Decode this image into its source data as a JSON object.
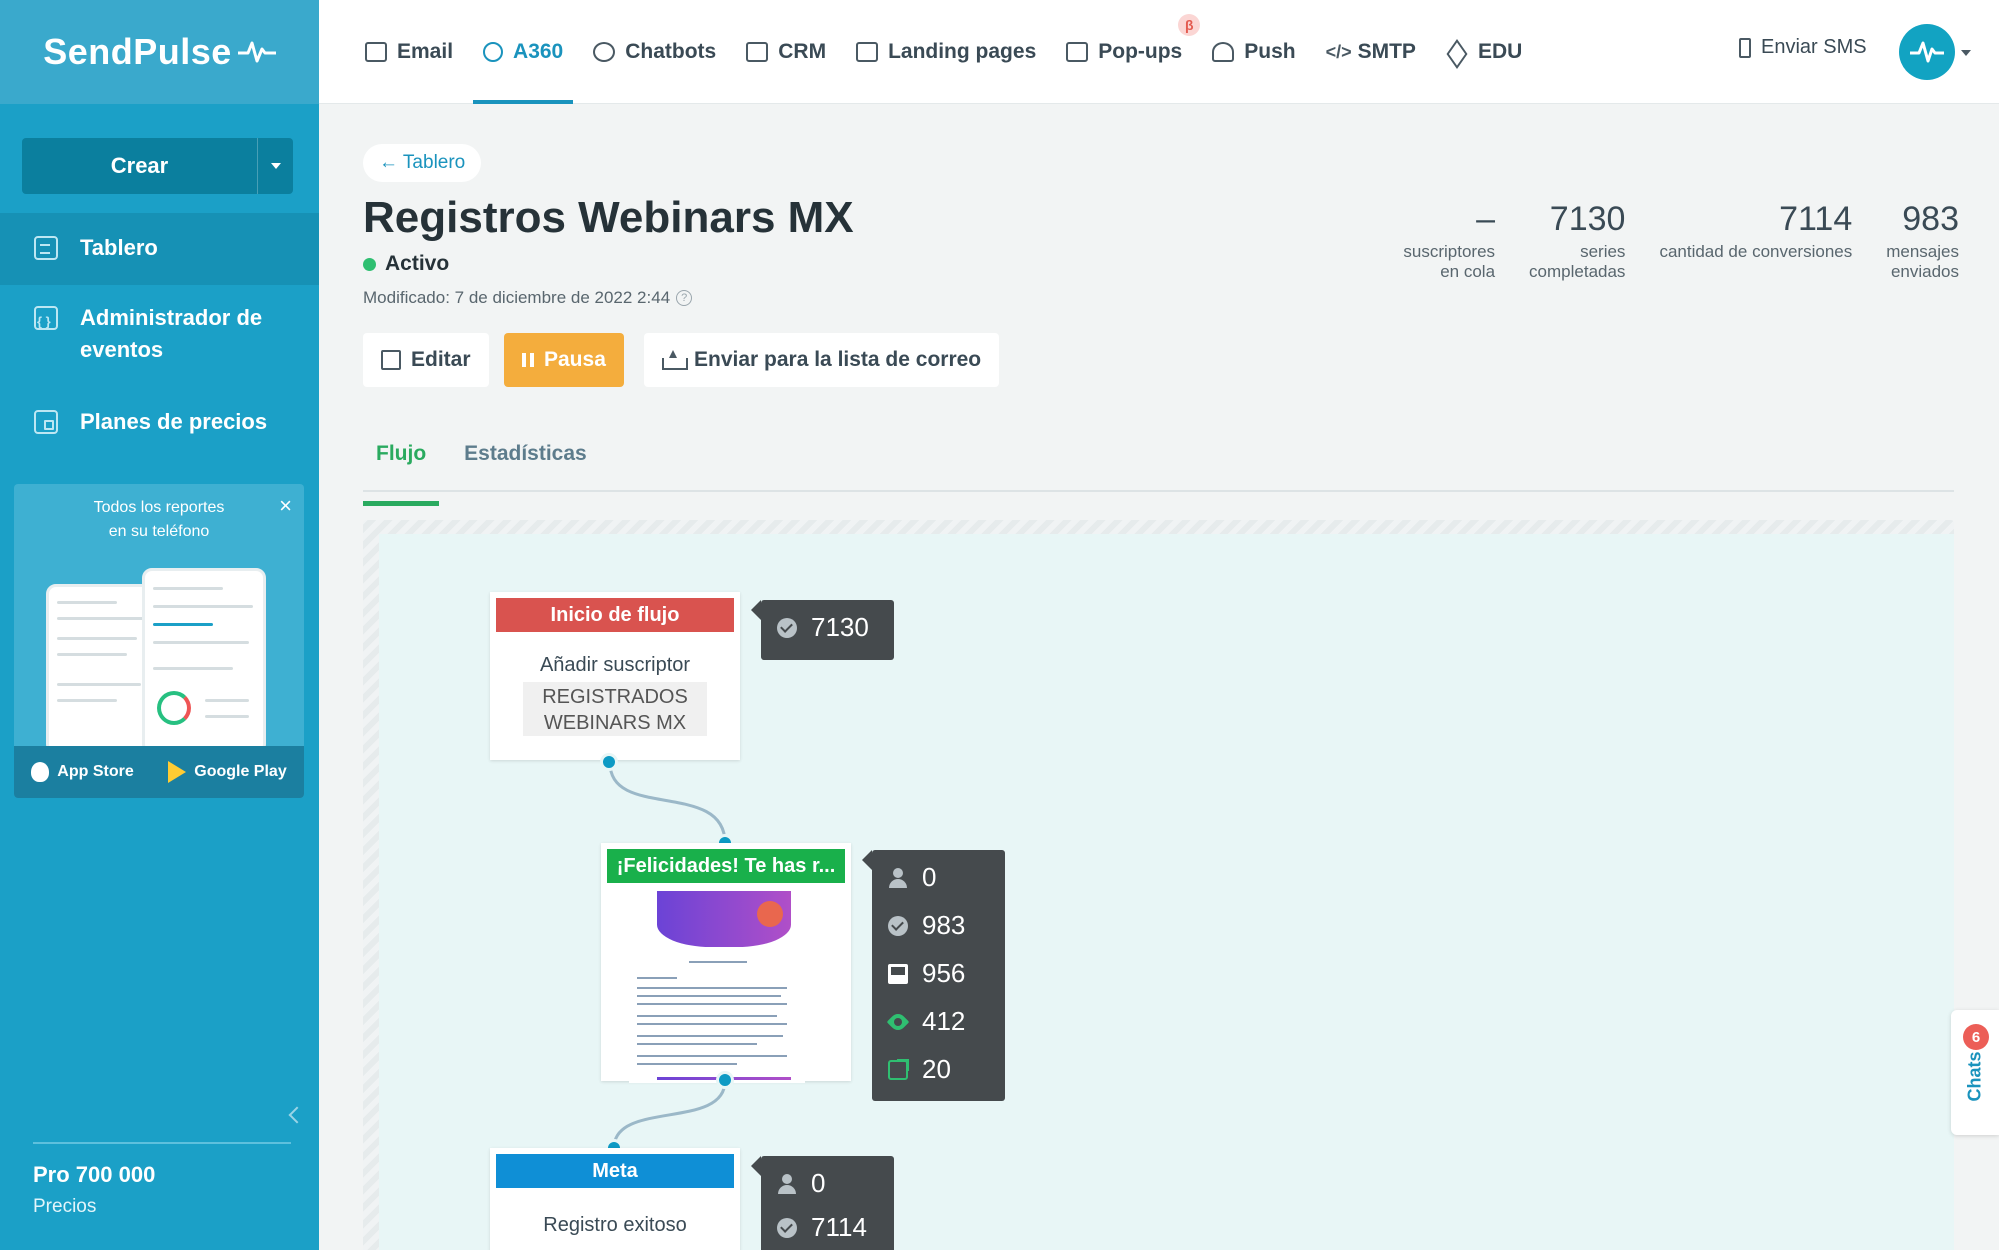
{
  "app": {
    "brand": "SendPulse",
    "sidebar": {
      "create_label": "Crear",
      "items": [
        {
          "label": "Tablero",
          "icon": "dashboard-icon",
          "active": true
        },
        {
          "label": "Administrador de eventos",
          "icon": "events-icon",
          "active": false
        },
        {
          "label": "Planes de precios",
          "icon": "wallet-icon",
          "active": false
        }
      ],
      "promo": {
        "text_line1": "Todos los reportes",
        "text_line2": "en su teléfono",
        "app_store": "App Store",
        "google_play": "Google Play"
      },
      "plan_name": "Pro 700 000",
      "plan_link": "Precios"
    },
    "topnav": [
      {
        "label": "Email",
        "icon": "envelope-icon"
      },
      {
        "label": "A360",
        "icon": "automation-icon",
        "active": true
      },
      {
        "label": "Chatbots",
        "icon": "chat-icon"
      },
      {
        "label": "CRM",
        "icon": "crm-icon"
      },
      {
        "label": "Landing pages",
        "icon": "landing-icon"
      },
      {
        "label": "Pop-ups",
        "icon": "popup-icon",
        "badge": "β"
      },
      {
        "label": "Push",
        "icon": "bell-icon"
      },
      {
        "label": "SMTP",
        "icon": "code-icon"
      },
      {
        "label": "EDU",
        "icon": "graduation-cap-icon"
      }
    ],
    "sms_label": "Enviar SMS"
  },
  "page": {
    "back_label": "← Tablero",
    "title": "Registros Webinars MX",
    "status": "Activo",
    "modified": "Modificado: 7 de diciembre de 2022 2:44",
    "stats": [
      {
        "value": "–",
        "label_line1": "suscriptores",
        "label_line2": "en cola"
      },
      {
        "value": "7130",
        "label_line1": "series",
        "label_line2": "completadas"
      },
      {
        "value": "7114",
        "label_line1": "cantidad de conversiones",
        "label_line2": ""
      },
      {
        "value": "983",
        "label_line1": "mensajes",
        "label_line2": "enviados"
      }
    ],
    "buttons": {
      "edit": "Editar",
      "pause": "Pausa",
      "send_list": "Enviar para la lista de correo"
    },
    "tabs": [
      {
        "label": "Flujo",
        "active": true
      },
      {
        "label": "Estadísticas",
        "active": false
      }
    ]
  },
  "flow": {
    "start": {
      "header": "Inicio de flujo",
      "subtitle": "Añadir suscriptor",
      "list_line1": "REGISTRADOS",
      "list_line2": "WEBINARS MX",
      "stat_completed": "7130"
    },
    "email": {
      "header": "¡Felicidades! Te has r...",
      "stats": {
        "queued": "0",
        "sent": "983",
        "delivered": "956",
        "opened": "412",
        "clicked": "20"
      }
    },
    "goal": {
      "header": "Meta",
      "subtitle": "Registro exitoso",
      "stats": {
        "queued": "0",
        "reached": "7114"
      }
    }
  },
  "chats": {
    "label": "Chats",
    "badge": "6"
  },
  "colors": {
    "sidebar": "#1ba0c7",
    "accent": "#1a93bd",
    "start_header": "#d9534f",
    "email_header": "#19b04b",
    "goal_header": "#0f8fd6",
    "pause_button": "#f4ad3d"
  }
}
